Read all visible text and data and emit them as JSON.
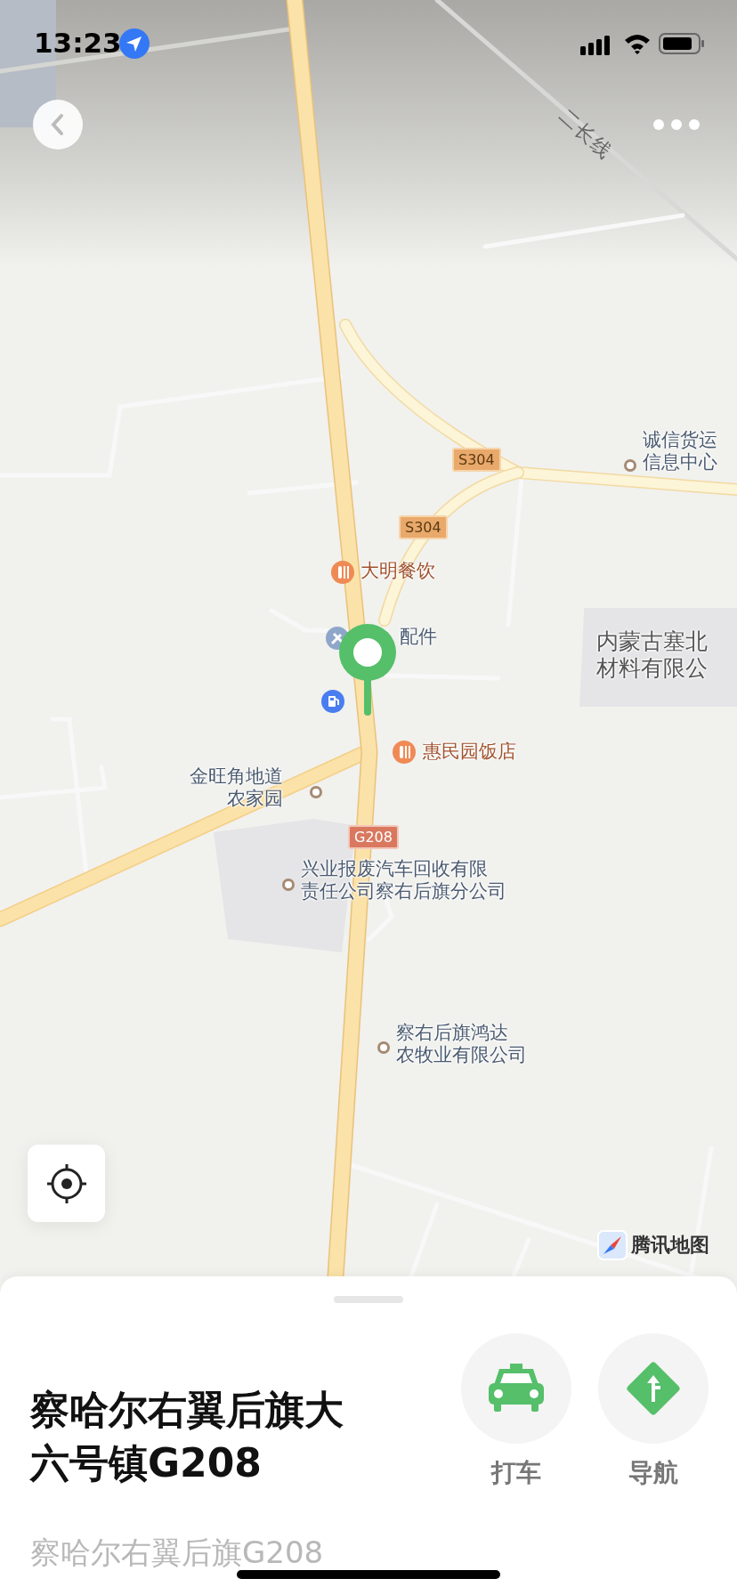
{
  "status_bar": {
    "time": "13:23"
  },
  "map": {
    "road_labels": [
      "二长线"
    ],
    "route_shields": [
      {
        "text": "S304",
        "kind": "provincial"
      },
      {
        "text": "S304",
        "kind": "provincial"
      },
      {
        "text": "G208",
        "kind": "national"
      }
    ],
    "places": [
      {
        "kind": "poi",
        "lines": [
          "诚信货运",
          "信息中心"
        ]
      },
      {
        "kind": "restaurant",
        "lines": [
          "大明餐饮"
        ]
      },
      {
        "kind": "repair",
        "lines": [
          "配件"
        ]
      },
      {
        "kind": "gas"
      },
      {
        "kind": "area",
        "lines": [
          "内蒙古塞北",
          "材料有限公"
        ]
      },
      {
        "kind": "restaurant",
        "lines": [
          "惠民园饭店"
        ]
      },
      {
        "kind": "poi",
        "lines": [
          "金旺角地道",
          "农家园"
        ]
      },
      {
        "kind": "poi",
        "lines": [
          "兴业报废汽车回收有限",
          "责任公司察右后旗分公司"
        ]
      },
      {
        "kind": "poi",
        "lines": [
          "察右后旗鸿达",
          "农牧业有限公司"
        ]
      }
    ],
    "attribution": "腾讯地图"
  },
  "sheet": {
    "title": "察哈尔右翼后旗大六号镇G208",
    "subtitle": "察哈尔右翼后旗G208",
    "actions": [
      {
        "label": "打车",
        "kind": "taxi"
      },
      {
        "label": "导航",
        "kind": "navigate"
      }
    ]
  }
}
